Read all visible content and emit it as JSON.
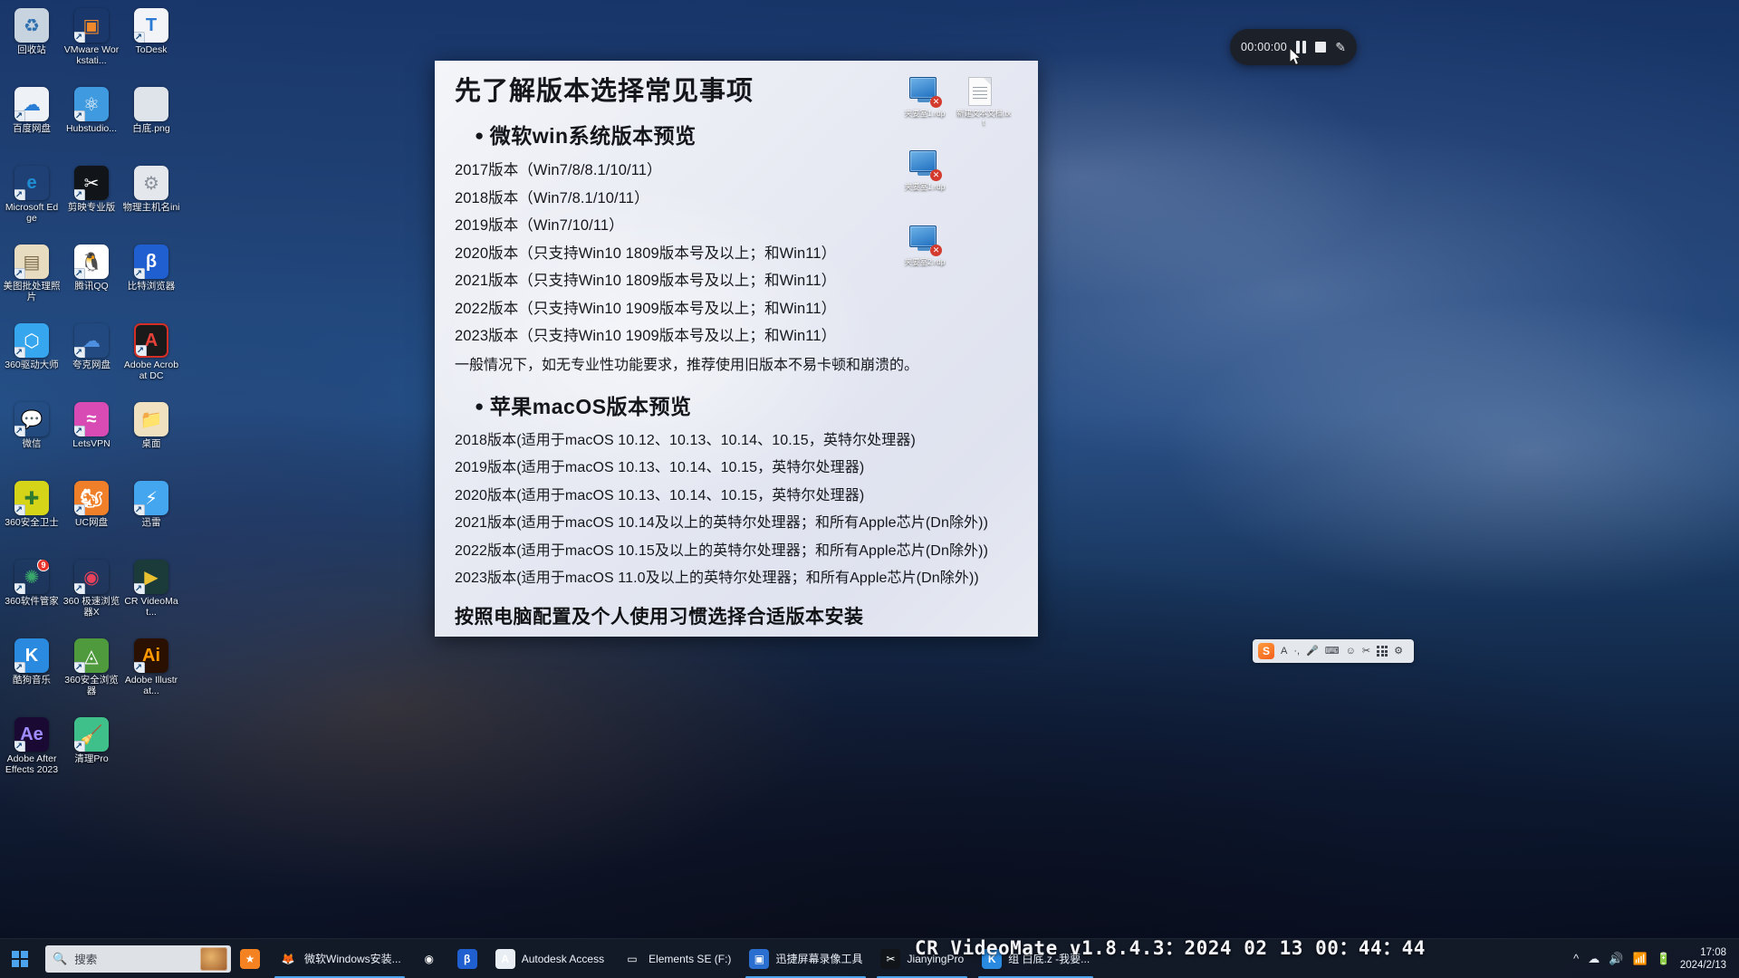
{
  "desktop": {
    "icons": [
      {
        "label": "回收站",
        "icon": "recycle-bin-icon",
        "color": "#c7d3de",
        "glyph": "♻",
        "text": "#2e6fb0",
        "shortcut": false
      },
      {
        "label": "VMware Workstati...",
        "icon": "vmware-icon",
        "color": "transparent",
        "glyph": "▣",
        "text": "#f0892a",
        "shortcut": true
      },
      {
        "label": "ToDesk",
        "icon": "todesk-icon",
        "color": "#f2f4f7",
        "glyph": "T",
        "text": "#2a7ad4",
        "shortcut": true
      },
      {
        "label": "百度网盘",
        "icon": "baidu-netdisk-icon",
        "color": "#eef2f6",
        "glyph": "☁",
        "text": "#2b7ed6",
        "shortcut": true
      },
      {
        "label": "Hubstudio...",
        "icon": "hubstudio-icon",
        "color": "#3f9ae0",
        "glyph": "⚛",
        "text": "#ffffff",
        "shortcut": true
      },
      {
        "label": "白底.png",
        "icon": "image-file-icon",
        "color": "#dfe4ea",
        "glyph": "",
        "text": "#ffffff",
        "shortcut": false
      },
      {
        "label": "Microsoft Edge",
        "icon": "microsoft-edge-icon",
        "color": "transparent",
        "glyph": "e",
        "text": "#1e8fd5",
        "shortcut": true
      },
      {
        "label": "剪映专业版",
        "icon": "jianying-icon",
        "color": "#111418",
        "glyph": "✂",
        "text": "#ffffff",
        "shortcut": true
      },
      {
        "label": "物理主机名ini",
        "icon": "ini-file-icon",
        "color": "#e4e7ec",
        "glyph": "⚙",
        "text": "#8b929b",
        "shortcut": false
      },
      {
        "label": "美图批处理照片",
        "icon": "meitu-batch-icon",
        "color": "#e8dcc0",
        "glyph": "▤",
        "text": "#7a6a4a",
        "shortcut": true
      },
      {
        "label": "腾讯QQ",
        "icon": "tencent-qq-icon",
        "color": "#ffffff",
        "glyph": "🐧",
        "text": "#111111",
        "shortcut": true
      },
      {
        "label": "比特浏览器",
        "icon": "bit-browser-icon",
        "color": "#1f5fd0",
        "glyph": "β",
        "text": "#ffffff",
        "shortcut": true
      },
      {
        "label": "360驱动大师",
        "icon": "360-driver-master-icon",
        "color": "#36a6ee",
        "glyph": "⬡",
        "text": "#ffffff",
        "shortcut": true
      },
      {
        "label": "夸克网盘",
        "icon": "quark-netdisk-icon",
        "color": "transparent",
        "glyph": "☁",
        "text": "#4e8fe0",
        "shortcut": true
      },
      {
        "label": "Adobe Acrobat DC",
        "icon": "adobe-acrobat-icon",
        "color": "#1a1a1a",
        "glyph": "A",
        "text": "#e8413a",
        "shortcut": true,
        "border": "#d42f26"
      },
      {
        "label": "微信",
        "icon": "wechat-icon",
        "color": "transparent",
        "glyph": "💬",
        "text": "#5fb878",
        "shortcut": true
      },
      {
        "label": "LetsVPN",
        "icon": "letsvpn-icon",
        "color": "#d84bb5",
        "glyph": "≈",
        "text": "#ffffff",
        "shortcut": true
      },
      {
        "label": "桌面",
        "icon": "desktop-folder-icon",
        "color": "#f0e2c0",
        "glyph": "📁",
        "text": "#c9a24a",
        "shortcut": false
      },
      {
        "label": "360安全卫士",
        "icon": "360-safe-guard-icon",
        "color": "#d6d419",
        "glyph": "✚",
        "text": "#2f7a2f",
        "shortcut": true
      },
      {
        "label": "UC网盘",
        "icon": "uc-netdisk-icon",
        "color": "#f07f2a",
        "glyph": "🐿",
        "text": "#ffffff",
        "shortcut": true
      },
      {
        "label": "迅雷",
        "icon": "thunder-xunlei-icon",
        "color": "#43a6ef",
        "glyph": "⚡",
        "text": "#ffffff",
        "shortcut": true
      },
      {
        "label": "360软件管家",
        "icon": "360-software-manager-icon",
        "color": "transparent",
        "glyph": "✺",
        "text": "#3aa86a",
        "shortcut": true,
        "badge": "9"
      },
      {
        "label": "360 极速浏览器X",
        "icon": "360-speed-browser-icon",
        "color": "transparent",
        "glyph": "◉",
        "text": "#e8415c",
        "shortcut": true
      },
      {
        "label": "CR VideoMat...",
        "icon": "cr-videomate-icon",
        "color": "#1a3b3a",
        "glyph": "▶",
        "text": "#e8c030",
        "shortcut": true
      },
      {
        "label": "酷狗音乐",
        "icon": "kugou-music-icon",
        "color": "#2a8ae0",
        "glyph": "K",
        "text": "#ffffff",
        "shortcut": true
      },
      {
        "label": "360安全浏览器",
        "icon": "360-secure-browser-icon",
        "color": "#4f9a3c",
        "glyph": "◬",
        "text": "#ffffff",
        "shortcut": true
      },
      {
        "label": "Adobe Illustrat...",
        "icon": "adobe-illustrator-icon",
        "color": "#2a1000",
        "glyph": "Ai",
        "text": "#ff9a00",
        "shortcut": true
      },
      {
        "label": "Adobe After Effects 2023",
        "icon": "adobe-after-effects-icon",
        "color": "#1a0a33",
        "glyph": "Ae",
        "text": "#9f8cff",
        "shortcut": true
      },
      {
        "label": "清理Pro",
        "icon": "cleaner-pro-icon",
        "color": "#3fc08a",
        "glyph": "🧹",
        "text": "#ffffff",
        "shortcut": true
      }
    ]
  },
  "document": {
    "title": "先了解版本选择常见事项",
    "windows_section_heading": "微软win系统版本预览",
    "windows_versions": [
      "2017版本（Win7/8/8.1/10/11）",
      "2018版本（Win7/8.1/10/11）",
      "2019版本（Win7/10/11）",
      "2020版本（只支持Win10 1809版本号及以上；和Win11）",
      "2021版本（只支持Win10 1809版本号及以上；和Win11）",
      "2022版本（只支持Win10 1909版本号及以上；和Win11）",
      "2023版本（只支持Win10 1909版本号及以上；和Win11）"
    ],
    "windows_note": "一般情况下，如无专业性功能要求，推荐使用旧版本不易卡顿和崩溃的。",
    "macos_section_heading": "苹果macOS版本预览",
    "macos_versions": [
      "2018版本(适用于macOS 10.12、10.13、10.14、10.15，英特尔处理器)",
      "2019版本(适用于macOS 10.13、10.14、10.15，英特尔处理器)",
      "2020版本(适用于macOS 10.13、10.14、10.15，英特尔处理器)",
      "2021版本(适用于macOS 10.14及以上的英特尔处理器；和所有Apple芯片(Dn除外))",
      "2022版本(适用于macOS 10.15及以上的英特尔处理器；和所有Apple芯片(Dn除外))",
      "2023版本(适用于macOS 11.0及以上的英特尔处理器；和所有Apple芯片(Dn除外))"
    ],
    "footer": "按照电脑配置及个人使用习惯选择合适版本安装",
    "overlay_icons": [
      {
        "label": "夹要室1.rdp",
        "type": "rdp"
      },
      {
        "label": "新建文本文档.txt",
        "type": "txt"
      },
      {
        "label": "夹要室1.rdp",
        "type": "rdp"
      },
      {
        "label": "夹要室2.rdp",
        "type": "rdp"
      }
    ]
  },
  "recorder": {
    "time": "00:00:00",
    "pause_label": "pause",
    "stop_label": "stop",
    "draw_label": "draw"
  },
  "ime": {
    "logo": "S",
    "items": [
      "A",
      "·,",
      "🎤",
      "⌨",
      "☺",
      "✂",
      "⊞",
      "⚙"
    ]
  },
  "taskbar": {
    "search_placeholder": "搜索",
    "items": [
      {
        "label": "",
        "icon": "star-app-icon",
        "color": "#f58220",
        "glyph": "★",
        "active": false
      },
      {
        "label": "微软Windows安装...",
        "icon": "firefox-browser-icon",
        "color": "transparent",
        "glyph": "🦊",
        "active": true
      },
      {
        "label": "",
        "icon": "green-circle-app-icon",
        "color": "transparent",
        "glyph": "◉",
        "active": false
      },
      {
        "label": "",
        "icon": "bit-browser-taskbar-icon",
        "color": "#1f5fd0",
        "glyph": "β",
        "active": false
      },
      {
        "label": "Autodesk Access",
        "icon": "autodesk-access-icon",
        "color": "#e9eef4",
        "glyph": "A",
        "active": false
      },
      {
        "label": "Elements SE (F:)",
        "icon": "external-drive-icon",
        "color": "transparent",
        "glyph": "▭",
        "active": false
      },
      {
        "label": "迅捷屏幕录像工具",
        "icon": "screen-recorder-icon",
        "color": "#2a6fd0",
        "glyph": "▣",
        "active": true
      },
      {
        "label": "JianyingPro",
        "icon": "jianying-pro-icon",
        "color": "#111418",
        "glyph": "✂",
        "active": true
      },
      {
        "label": "组 白底.z -我要...",
        "icon": "group-window-icon",
        "color": "#2a8ae0",
        "glyph": "K",
        "active": true
      }
    ],
    "clock_time": "17:08",
    "clock_date": "2024/2/13",
    "tray_icons": [
      "^",
      "☁",
      "🔊",
      "📶",
      "🔋"
    ]
  },
  "watermark": {
    "text": "CR VideoMate v1.8.4.3：2024 02 13 00：44：44"
  }
}
